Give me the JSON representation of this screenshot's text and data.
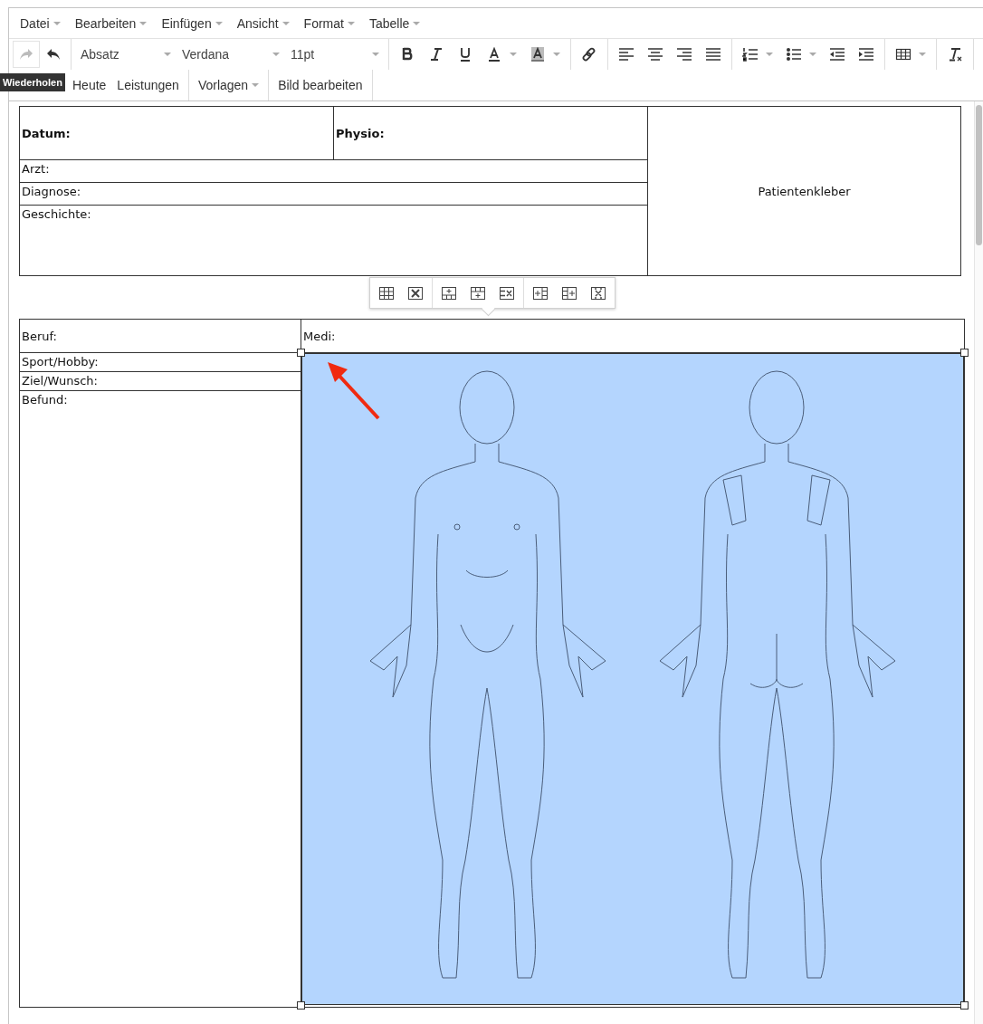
{
  "menubar": [
    {
      "label": "Datei"
    },
    {
      "label": "Bearbeiten"
    },
    {
      "label": "Einfügen"
    },
    {
      "label": "Ansicht"
    },
    {
      "label": "Format"
    },
    {
      "label": "Tabelle"
    }
  ],
  "toolbar": {
    "history": [
      {
        "kind": "redo",
        "disabled": true
      },
      {
        "kind": "undo",
        "disabled": false
      }
    ],
    "selects": [
      {
        "value": "Absatz"
      },
      {
        "value": "Verdana"
      },
      {
        "value": "11pt"
      }
    ],
    "groups": [
      [
        {
          "kind": "bold",
          "dropdown": false
        },
        {
          "kind": "italic",
          "dropdown": false
        },
        {
          "kind": "underline",
          "dropdown": false
        },
        {
          "kind": "textcolor",
          "dropdown": true
        },
        {
          "kind": "bgcolor",
          "dropdown": true
        }
      ],
      [
        {
          "kind": "link",
          "dropdown": false
        }
      ],
      [
        {
          "kind": "alignleft",
          "dropdown": false
        },
        {
          "kind": "aligncenter",
          "dropdown": false
        },
        {
          "kind": "alignright",
          "dropdown": false
        },
        {
          "kind": "justify",
          "dropdown": false
        }
      ],
      [
        {
          "kind": "numlist",
          "dropdown": true
        },
        {
          "kind": "bullist",
          "dropdown": true
        },
        {
          "kind": "outdent",
          "dropdown": false
        },
        {
          "kind": "indent",
          "dropdown": false
        }
      ],
      [
        {
          "kind": "table",
          "dropdown": true
        }
      ],
      [
        {
          "kind": "clearformat",
          "dropdown": false
        }
      ]
    ]
  },
  "tooltip": "Wiederholen",
  "toolbar2": [
    {
      "label": "Heute",
      "dropdown": false
    },
    {
      "label": "Leistungen",
      "dropdown": false
    },
    {
      "label": "Vorlagen",
      "dropdown": true
    },
    {
      "label": "Bild bearbeiten",
      "dropdown": false
    }
  ],
  "table1": {
    "datum": "Datum:",
    "physio": "Physio:",
    "sticker": "Patientenkleber",
    "rows": [
      "Arzt:",
      "Diagnose:",
      "Geschichte:"
    ]
  },
  "table_toolbar": [
    [
      {
        "kind": "table"
      },
      {
        "kind": "delete"
      }
    ],
    [
      {
        "kind": "rowbefore"
      },
      {
        "kind": "rowafter"
      },
      {
        "kind": "deleterow"
      }
    ],
    [
      {
        "kind": "colbefore"
      },
      {
        "kind": "colafter"
      },
      {
        "kind": "deletecol"
      }
    ]
  ],
  "table2": {
    "beruf": "Beruf:",
    "medi": "Medi:",
    "rows": [
      "Sport/Hobby:",
      "Ziel/Wunsch:",
      "Befund:"
    ]
  },
  "image": {
    "selected": true
  }
}
